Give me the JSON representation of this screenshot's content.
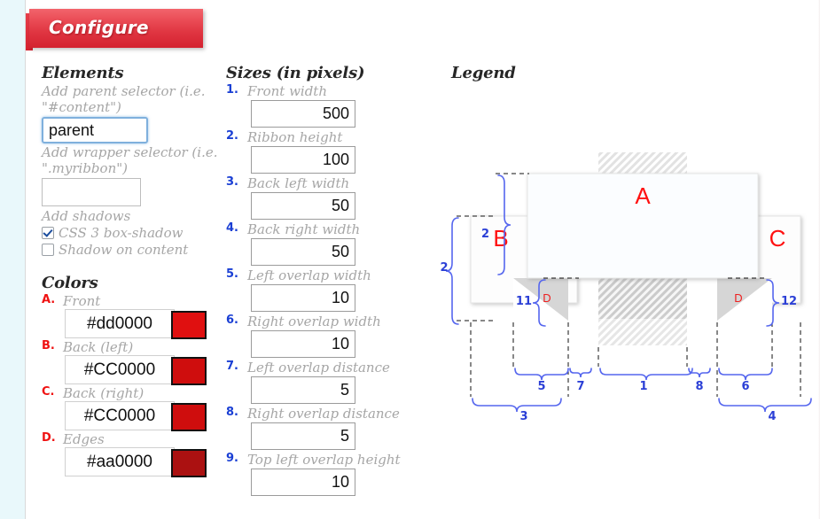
{
  "ribbon": {
    "title": "Configure"
  },
  "elements": {
    "heading": "Elements",
    "parent_label": "Add parent selector (i.e. \"#content\")",
    "parent_value": "parent",
    "wrapper_label": "Add wrapper selector (i.e. \".myribbon\")",
    "wrapper_value": "",
    "shadows_label": "Add shadows",
    "checkboxes": [
      {
        "label": "CSS 3 box-shadow",
        "checked": true
      },
      {
        "label": "Shadow on content",
        "checked": false
      }
    ]
  },
  "colors": {
    "heading": "Colors",
    "items": [
      {
        "key": "A.",
        "label": "Front",
        "value": "#dd0000",
        "swatch": "#e01010"
      },
      {
        "key": "B.",
        "label": "Back (left)",
        "value": "#CC0000",
        "swatch": "#cf0d0d"
      },
      {
        "key": "C.",
        "label": "Back (right)",
        "value": "#CC0000",
        "swatch": "#cf0d0d"
      },
      {
        "key": "D.",
        "label": "Edges",
        "value": "#aa0000",
        "swatch": "#ab1111"
      }
    ]
  },
  "sizes": {
    "heading": "Sizes (in pixels)",
    "items": [
      {
        "num": "1.",
        "label": "Front width",
        "value": "500"
      },
      {
        "num": "2.",
        "label": "Ribbon height",
        "value": "100"
      },
      {
        "num": "3.",
        "label": "Back left width",
        "value": "50"
      },
      {
        "num": "4.",
        "label": "Back right width",
        "value": "50"
      },
      {
        "num": "5.",
        "label": "Left overlap width",
        "value": "10"
      },
      {
        "num": "6.",
        "label": "Right overlap width",
        "value": "10"
      },
      {
        "num": "7.",
        "label": "Left overlap distance",
        "value": "5"
      },
      {
        "num": "8.",
        "label": "Right overlap distance",
        "value": "5"
      },
      {
        "num": "9.",
        "label": "Top left overlap height",
        "value": "10"
      }
    ]
  },
  "legend": {
    "heading": "Legend",
    "panels": [
      {
        "id": "A",
        "role": "front"
      },
      {
        "id": "B",
        "role": "back-left"
      },
      {
        "id": "C",
        "role": "back-right"
      },
      {
        "id": "D",
        "role": "edge-left"
      },
      {
        "id": "D",
        "role": "edge-right"
      }
    ],
    "measure_labels": [
      {
        "text": "2",
        "ref": "ribbon-height-front"
      },
      {
        "text": "2",
        "ref": "ribbon-height-back"
      },
      {
        "text": "11",
        "ref": "top-left-overlap-height"
      },
      {
        "text": "12",
        "ref": "top-right-overlap-height"
      },
      {
        "text": "5",
        "ref": "left-overlap-width"
      },
      {
        "text": "7",
        "ref": "left-overlap-distance"
      },
      {
        "text": "1",
        "ref": "front-width"
      },
      {
        "text": "8",
        "ref": "right-overlap-distance"
      },
      {
        "text": "6",
        "ref": "right-overlap-width"
      },
      {
        "text": "3",
        "ref": "back-left-width"
      },
      {
        "text": "4",
        "ref": "back-right-width"
      }
    ],
    "accent_blue": "#3b4fd8",
    "accent_red": "#ff1111"
  }
}
